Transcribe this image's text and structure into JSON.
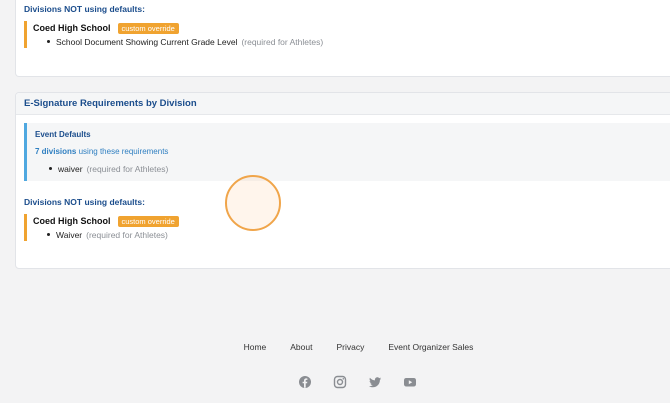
{
  "top_section": {
    "non_default_heading": "Divisions NOT using defaults:",
    "override": {
      "division": "Coed High School",
      "badge": "custom override",
      "item": "School Document Showing Current Grade Level",
      "note": "(required for Athletes)"
    }
  },
  "esignature": {
    "title": "E-Signature Requirements by Division",
    "defaults": {
      "title": "Event Defaults",
      "count_link": "7 divisions",
      "count_suffix": "using these requirements",
      "item": "waiver",
      "note": "(required for Athletes)"
    },
    "non_default_heading": "Divisions NOT using defaults:",
    "override": {
      "division": "Coed High School",
      "badge": "custom override",
      "item": "Waiver",
      "note": "(required for Athletes)"
    }
  },
  "footer": {
    "links": [
      "Home",
      "About",
      "Privacy",
      "Event Organizer Sales"
    ],
    "social_icons": [
      "facebook-icon",
      "instagram-icon",
      "twitter-icon",
      "youtube-icon"
    ]
  },
  "colors": {
    "accent_orange": "#f0a330",
    "heading_blue": "#1b4d8c",
    "link_blue": "#2f7fc1",
    "defaults_border": "#4fa8e0"
  }
}
